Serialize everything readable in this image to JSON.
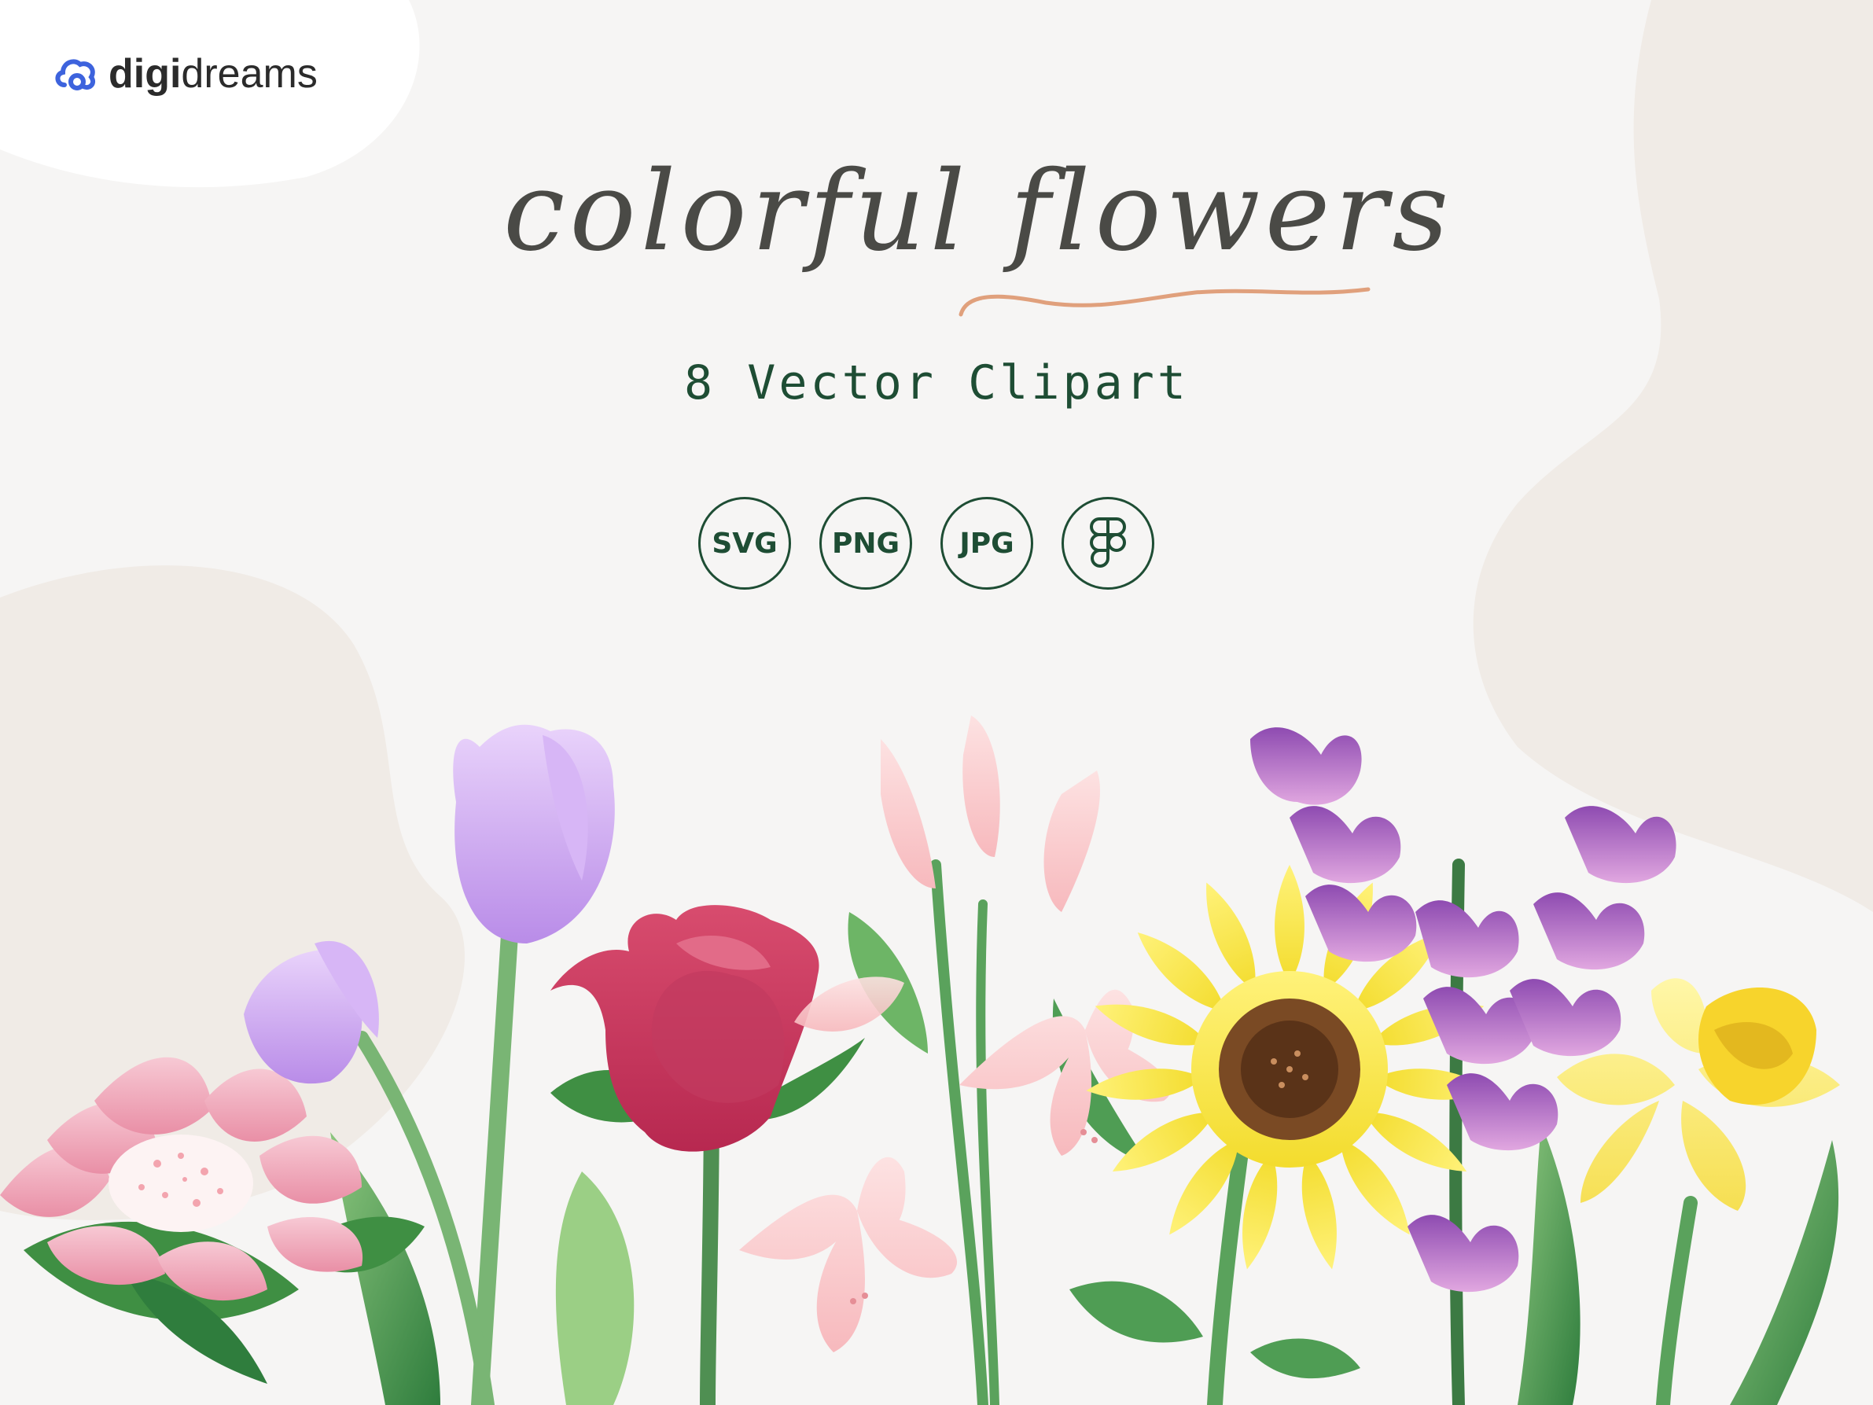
{
  "brand": {
    "name_bold": "digi",
    "name_light": "dreams"
  },
  "hero": {
    "title": "colorful flowers",
    "subtitle": "8 Vector Clipart"
  },
  "formats": [
    "SVG",
    "PNG",
    "JPG"
  ],
  "icons": {
    "logo": "cloud-logo-icon",
    "format_extra": "figma-icon"
  },
  "colors": {
    "background": "#f6f5f4",
    "blob": "#f0ebe6",
    "title": "#4a4a46",
    "accent_green": "#1e4d34",
    "underline": "#e0a07c",
    "logo_blue": "#3d63dd"
  }
}
